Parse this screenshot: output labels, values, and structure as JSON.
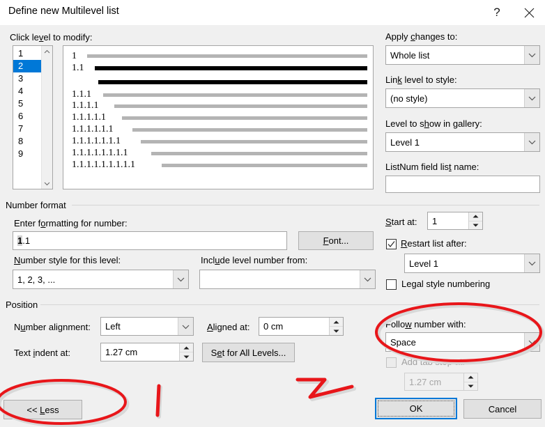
{
  "window": {
    "title": "Define new Multilevel list",
    "help_label": "?",
    "close_label": "×",
    "help_icon": "question-mark-icon",
    "close_icon": "close-x-icon"
  },
  "level_section": {
    "label": "Click level to modify:",
    "levels": [
      "1",
      "2",
      "3",
      "4",
      "5",
      "6",
      "7",
      "8",
      "9"
    ],
    "selected_level": "2",
    "selected_index": 1,
    "scroll_up_icon": "chevron-up-icon",
    "scroll_down_icon": "chevron-down-icon"
  },
  "preview": {
    "rows": [
      {
        "number": "1",
        "highlighted": false
      },
      {
        "number": "1.1",
        "highlighted": true
      },
      {
        "number": "",
        "highlighted": true
      },
      {
        "number": "1.1.1",
        "highlighted": false
      },
      {
        "number": "1.1.1.1",
        "highlighted": false
      },
      {
        "number": "1.1.1.1.1",
        "highlighted": false
      },
      {
        "number": "1.1.1.1.1.1",
        "highlighted": false
      },
      {
        "number": "1.1.1.1.1.1.1",
        "highlighted": false
      },
      {
        "number": "1.1.1.1.1.1.1.1",
        "highlighted": false
      },
      {
        "number": "1.1.1.1.1.1.1.1.1",
        "highlighted": false
      }
    ]
  },
  "right_panel": {
    "apply_changes_label": "Apply changes to:",
    "apply_changes_value": "Whole list",
    "link_level_label": "Link level to style:",
    "link_level_value": "(no style)",
    "gallery_level_label": "Level to show in gallery:",
    "gallery_level_value": "Level 1",
    "listnum_label": "ListNum field list name:",
    "listnum_value": ""
  },
  "number_format": {
    "group_title": "Number format",
    "enter_formatting_label": "Enter formatting for number:",
    "enter_formatting_value": "1.1",
    "field_shaded_part": "1",
    "field_plain_part": ".1",
    "font_button": "Font...",
    "number_style_label": "Number style for this level:",
    "number_style_value": "1, 2, 3, ...",
    "include_level_label": "Include level number from:",
    "include_level_value": "",
    "start_at_label": "Start at:",
    "start_at_value": "1",
    "restart_label": "Restart list after:",
    "restart_checked": true,
    "restart_value": "Level 1",
    "legal_style_label": "Legal style numbering",
    "legal_style_checked": false
  },
  "position": {
    "group_title": "Position",
    "number_alignment_label": "Number alignment:",
    "number_alignment_value": "Left",
    "aligned_at_label": "Aligned at:",
    "aligned_at_value": "0 cm",
    "text_indent_label": "Text indent at:",
    "text_indent_value": "1.27 cm",
    "set_all_levels_button": "Set for All Levels...",
    "follow_number_label": "Follow number with:",
    "follow_number_value": "Space",
    "add_tab_stop_label": "Add tab stop at:",
    "add_tab_stop_checked": false,
    "add_tab_stop_value": "1.27 cm"
  },
  "footer": {
    "less_button": "<< Less",
    "ok_button": "OK",
    "cancel_button": "Cancel"
  },
  "colors": {
    "accent": "#0078d7",
    "annotation_red": "#e8161a",
    "dialog_bg": "#f0f0f0",
    "preview_bar": "#b4b4b4",
    "preview_highlight": "#000000"
  },
  "annotations": {
    "ellipse_follow_number": "red-ellipse-follow-number-with",
    "ellipse_less_button": "red-ellipse-less-button",
    "arrow_mark": "red-arrow-mark",
    "tick_mark": "red-vertical-tick-mark"
  }
}
